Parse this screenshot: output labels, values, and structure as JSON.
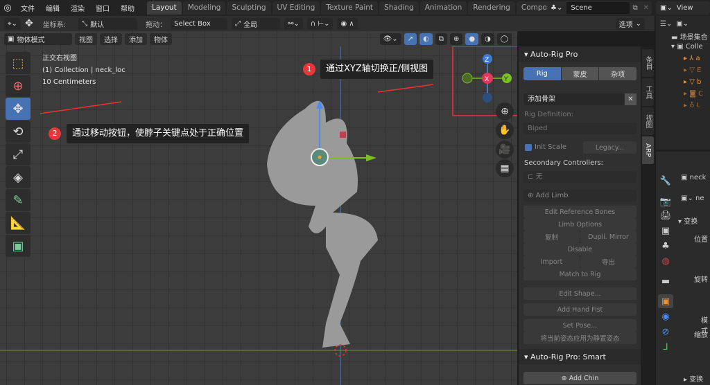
{
  "topbar": {
    "menus": [
      "文件",
      "编辑",
      "渲染",
      "窗口",
      "帮助"
    ],
    "workspaces": [
      "Layout",
      "Modeling",
      "Sculpting",
      "UV Editing",
      "Texture Paint",
      "Shading",
      "Animation",
      "Rendering",
      "Compositing"
    ],
    "active_workspace": "Layout",
    "scene": "Scene",
    "view_layer": "View"
  },
  "header": {
    "coord_label": "坐标系:",
    "coord_value": "默认",
    "drag_label": "拖动：",
    "drag_value": "Select Box",
    "pivot": "全局",
    "options": "选项"
  },
  "header2": {
    "mode": "物体模式",
    "menus": [
      "视图",
      "选择",
      "添加",
      "物体"
    ]
  },
  "viewport": {
    "view_name": "正交右视图",
    "collection": "(1) Collection | neck_loc",
    "scale": "10 Centimeters",
    "gizmo": {
      "z": "Z",
      "x": "X",
      "y": "Y"
    }
  },
  "annotations": [
    {
      "num": "1",
      "text": "通过XYZ轴切换正/侧视图"
    },
    {
      "num": "2",
      "text": "通过移动按钮，使脖子关键点处于正确位置"
    }
  ],
  "npanel": {
    "title": "Auto-Rig Pro",
    "tabs": [
      "Rig",
      "蒙皮",
      "杂项"
    ],
    "active_tab": "Rig",
    "add_armature": "添加骨架",
    "rig_def_label": "Rig Definition:",
    "rig_def": "Biped",
    "init_scale": "Init Scale",
    "legacy": "Legacy...",
    "secondary_label": "Secondary Controllers:",
    "secondary": "无",
    "add_limb": "Add Limb",
    "edit_ref": "Edit Reference Bones",
    "limb_opts": "Limb Options",
    "copy": "复制",
    "dupli": "Dupli. Mirror",
    "disable": "Disable",
    "import": "Import",
    "export": "导出",
    "match": "Match to Rig",
    "edit_shape": "Edit Shape...",
    "hand_fist": "Add Hand Fist",
    "set_pose": "Set Pose...",
    "apply_rest": "将当前姿态应用为静置姿态",
    "smart_title": "Auto-Rig Pro: Smart",
    "add_chin": "Add Chin"
  },
  "side_tabs": [
    "条目",
    "工具",
    "视图",
    "ARP"
  ],
  "outliner": {
    "root": "场景集合",
    "collection": "Colle",
    "items": [
      "a",
      "E",
      "b",
      "C",
      "L"
    ]
  },
  "properties": {
    "object": "neck",
    "object2": "ne",
    "section": "变换",
    "location": "位置",
    "rotation": "旋转",
    "mode": "模式",
    "scale": "缩放",
    "delta": "变换"
  }
}
